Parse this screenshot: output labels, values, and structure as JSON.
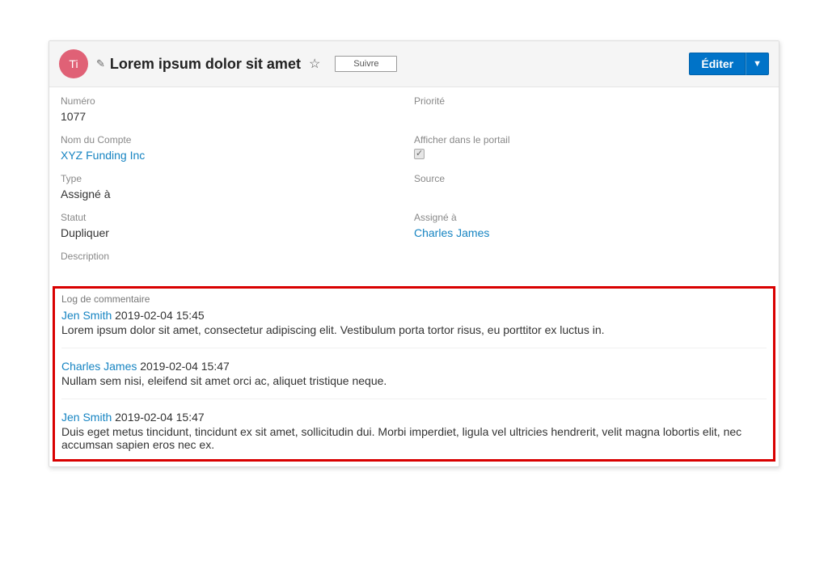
{
  "avatar": {
    "initials": "Ti",
    "bg": "#e06176"
  },
  "title": "Lorem ipsum dolor sit amet",
  "buttons": {
    "follow": "Suivre",
    "edit": "Éditer"
  },
  "fields": {
    "numero": {
      "label": "Numéro",
      "value": "1077"
    },
    "priorite": {
      "label": "Priorité",
      "value": ""
    },
    "account": {
      "label": "Nom du Compte",
      "value": "XYZ Funding Inc"
    },
    "portal": {
      "label": "Afficher dans le portail",
      "checked": true
    },
    "type": {
      "label": "Type",
      "value": "Assigné à"
    },
    "source": {
      "label": "Source",
      "value": ""
    },
    "statut": {
      "label": "Statut",
      "value": "Dupliquer"
    },
    "assigne": {
      "label": "Assigné à",
      "value": "Charles James"
    },
    "description": {
      "label": "Description",
      "value": ""
    }
  },
  "commentlog": {
    "title": "Log de commentaire",
    "items": [
      {
        "author": "Jen Smith",
        "ts": "2019-02-04 15:45",
        "text": "Lorem ipsum dolor sit amet, consectetur adipiscing elit. Vestibulum porta tortor risus, eu porttitor ex luctus in."
      },
      {
        "author": "Charles James",
        "ts": "2019-02-04 15:47",
        "text": "Nullam sem nisi, eleifend sit amet orci ac, aliquet tristique neque."
      },
      {
        "author": "Jen Smith",
        "ts": "2019-02-04 15:47",
        "text": "Duis eget metus tincidunt, tincidunt ex sit amet, sollicitudin dui. Morbi imperdiet, ligula vel ultricies hendrerit, velit magna lobortis elit, nec accumsan sapien eros nec ex."
      }
    ]
  }
}
